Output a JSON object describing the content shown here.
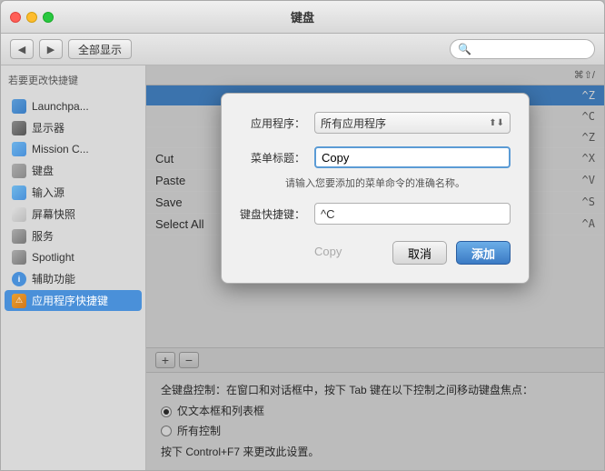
{
  "window": {
    "title": "键盘"
  },
  "toolbar": {
    "back_label": "◀",
    "forward_label": "▶",
    "show_all_label": "全部显示",
    "search_placeholder": ""
  },
  "sidebar": {
    "hint": "若要更改快捷键",
    "items": [
      {
        "id": "launchpad",
        "label": "Launchpa...",
        "icon_class": "icon-launchpad"
      },
      {
        "id": "display",
        "label": "显示器",
        "icon_class": "icon-display"
      },
      {
        "id": "mission",
        "label": "Mission C...",
        "icon_class": "icon-mission"
      },
      {
        "id": "keyboard",
        "label": "键盘",
        "icon_class": "icon-keyboard"
      },
      {
        "id": "input",
        "label": "输入源",
        "icon_class": "icon-input"
      },
      {
        "id": "screenshot",
        "label": "屏幕快照",
        "icon_class": "icon-screenshot"
      },
      {
        "id": "services",
        "label": "服务",
        "icon_class": "icon-services"
      },
      {
        "id": "spotlight",
        "label": "Spotlight",
        "icon_class": "icon-spotlight"
      },
      {
        "id": "accessibility",
        "label": "辅助功能",
        "icon_class": "icon-accessibility"
      },
      {
        "id": "appshortcuts",
        "label": "应用程序快捷键",
        "icon_class": "icon-appshortcuts",
        "selected": true
      }
    ]
  },
  "list": {
    "header_label": "",
    "shortcut_header": "⌘⇧/",
    "rows": [
      {
        "label": "",
        "shortcut": "^Z",
        "highlight": true
      },
      {
        "label": "",
        "shortcut": "^C",
        "highlight": false
      },
      {
        "label": "",
        "shortcut": "^Z",
        "highlight": false
      },
      {
        "label": "Cut",
        "shortcut": "^X",
        "highlight": false
      },
      {
        "label": "Paste",
        "shortcut": "^V",
        "highlight": false
      },
      {
        "label": "Save",
        "shortcut": "^S",
        "highlight": false
      },
      {
        "label": "Select All",
        "shortcut": "^A",
        "highlight": false
      }
    ],
    "add_btn": "+",
    "remove_btn": "−"
  },
  "bottom": {
    "hint": "全键盘控制：在窗口和对话框中，按下 Tab 键在以下控制之间移动键盘焦点：",
    "radio_options": [
      {
        "label": "仅文本框和列表框",
        "checked": true
      },
      {
        "label": "所有控制",
        "checked": false
      }
    ],
    "footer_hint": "按下 Control+F7 来更改此设置。"
  },
  "modal": {
    "title_label": "应用程序：",
    "app_value": "所有应用程序",
    "menu_label": "菜单标题：",
    "menu_value": "Copy",
    "menu_placeholder": "",
    "hint": "请输入您要添加的菜单命令的准确名称。",
    "shortcut_label": "键盘快捷键：",
    "shortcut_value": "^C",
    "ghost_label": "Copy",
    "cancel_label": "取消",
    "add_label": "添加"
  }
}
